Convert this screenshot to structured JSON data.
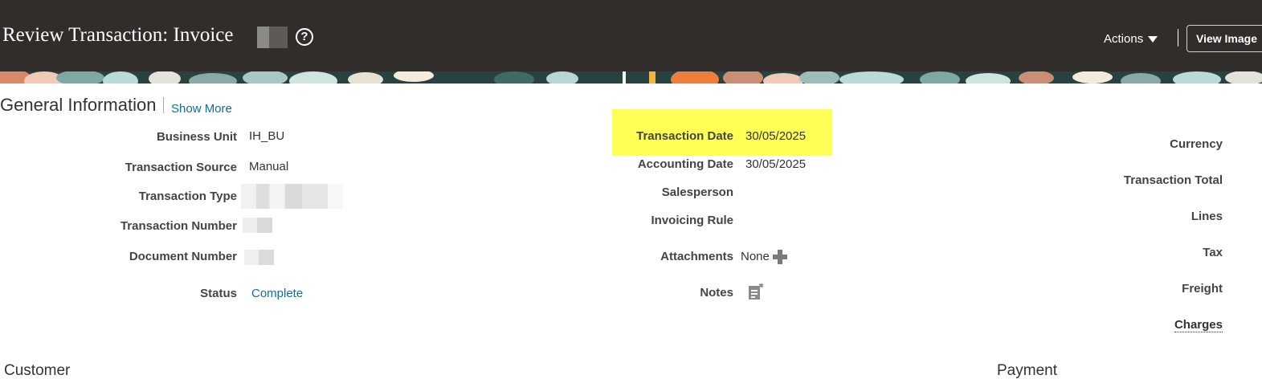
{
  "header": {
    "title": "Review Transaction: Invoice",
    "help_icon": "help-icon",
    "help_glyph": "?",
    "actions_label": "Actions",
    "view_image_label": "View Image"
  },
  "section": {
    "title": "General Information",
    "show_more": "Show More"
  },
  "left_fields": {
    "business_unit": {
      "label": "Business Unit",
      "value": "IH_BU"
    },
    "transaction_source": {
      "label": "Transaction Source",
      "value": "Manual"
    },
    "transaction_type": {
      "label": "Transaction Type"
    },
    "transaction_number": {
      "label": "Transaction Number"
    },
    "document_number": {
      "label": "Document Number"
    },
    "status": {
      "label": "Status",
      "value": "Complete"
    }
  },
  "middle_fields": {
    "transaction_date": {
      "label": "Transaction Date",
      "value": "30/05/2025"
    },
    "accounting_date": {
      "label": "Accounting Date",
      "value": "30/05/2025"
    },
    "salesperson": {
      "label": "Salesperson"
    },
    "invoicing_rule": {
      "label": "Invoicing Rule"
    },
    "attachments": {
      "label": "Attachments",
      "value": "None"
    },
    "notes": {
      "label": "Notes"
    }
  },
  "right_fields": {
    "currency": "Currency",
    "transaction_total": "Transaction Total",
    "lines": "Lines",
    "tax": "Tax",
    "freight": "Freight",
    "charges": "Charges"
  },
  "subsections": {
    "customer": "Customer",
    "payment": "Payment"
  },
  "colors": {
    "header_bg": "#312d2a",
    "link": "#0f6e96",
    "highlight": "#ffff55"
  }
}
